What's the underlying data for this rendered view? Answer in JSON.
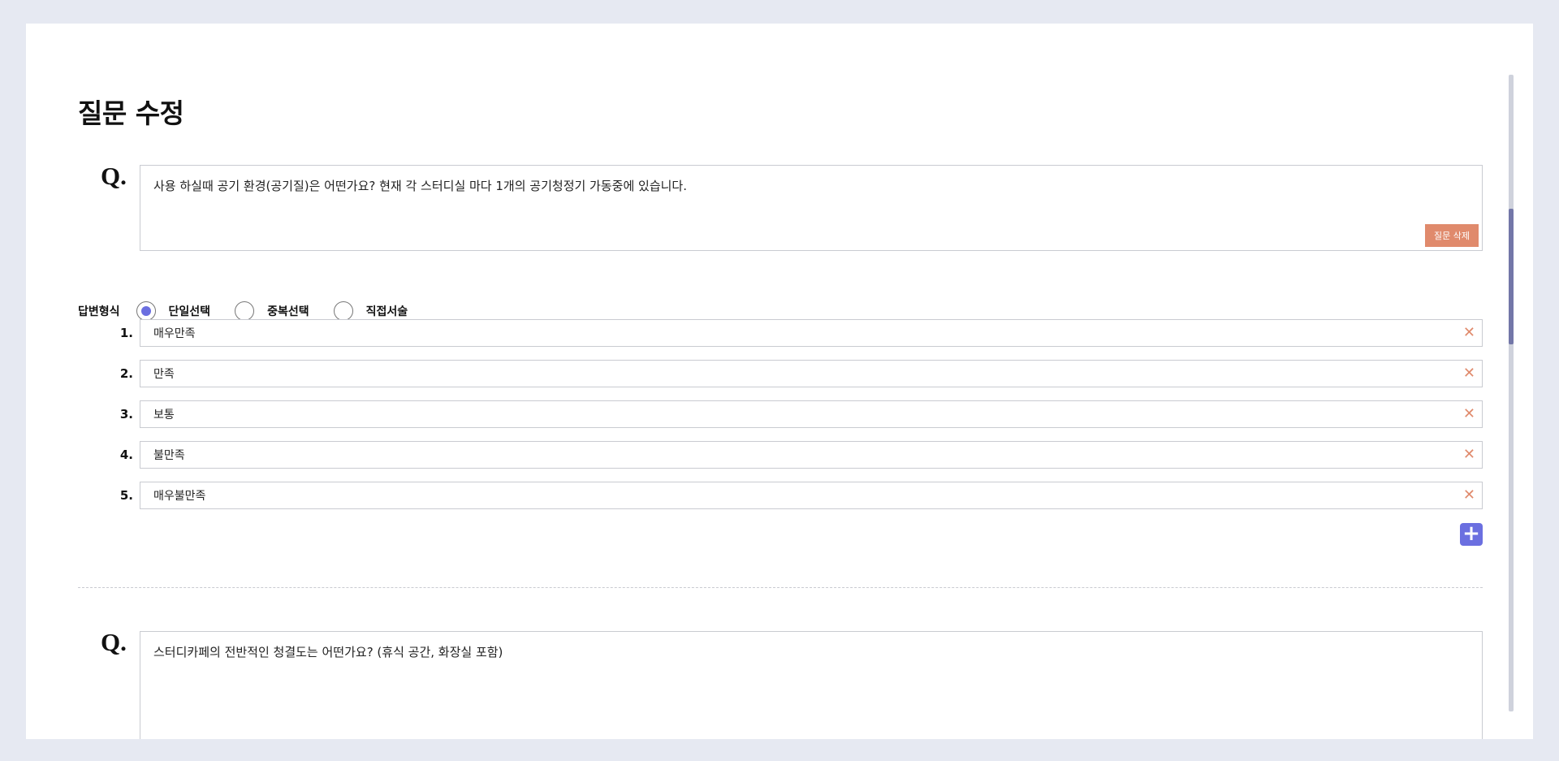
{
  "page_title": "질문 수정",
  "questions": [
    {
      "mark": "Q.",
      "text": "사용 하실때 공기 환경(공기질)은 어떤가요? 현재 각 스터디실 마다 1개의 공기청정기 가동중에 있습니다.",
      "delete_label": "질문 삭제"
    },
    {
      "mark": "Q.",
      "text": "스터디카페의 전반적인 청결도는 어떤가요? (휴식 공간, 화장실 포함)"
    }
  ],
  "answer_type": {
    "label": "답변형식",
    "options": [
      "단일선택",
      "중복선택",
      "직접서술"
    ],
    "selected": "단일선택"
  },
  "options": [
    {
      "num": "1.",
      "value": "매우만족",
      "remove": "✕"
    },
    {
      "num": "2.",
      "value": "만족",
      "remove": "✕"
    },
    {
      "num": "3.",
      "value": "보통",
      "remove": "✕"
    },
    {
      "num": "4.",
      "value": "불만족",
      "remove": "✕"
    },
    {
      "num": "5.",
      "value": "매우불만족",
      "remove": "✕"
    }
  ],
  "add_option_symbol": "+",
  "colors": {
    "accent": "#6b6fe0",
    "danger": "#e08a6c",
    "background": "#e6e9f2"
  }
}
